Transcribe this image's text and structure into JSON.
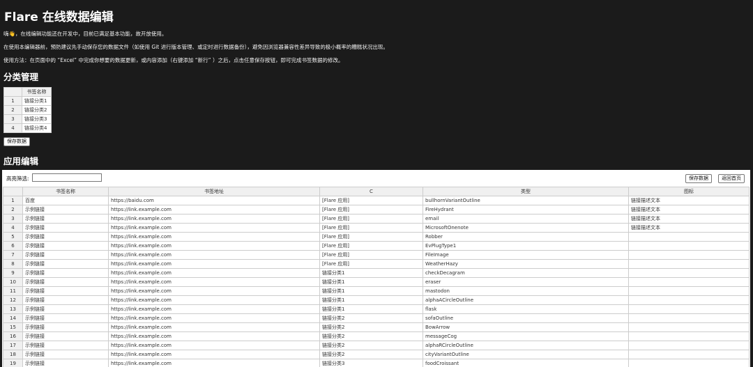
{
  "page": {
    "title": "Flare 在线数据编辑",
    "intro_1": "嗨👋，在线编辑功能还在开发中，目前已满足基本功能，故开放使用。",
    "intro_2": "在使用本编辑器前，预防建议先手动保存您的数据文件（如使用 Git 进行版本管理、或定时进行数据备份），避免因浏览器兼容性差异导致的极小概率的糟糕状况出现。",
    "intro_3": "使用方法：在页面中的 “Excel” 中完成你想要的数据更新，或内容添加（右键添加 “新行” ）之后，点击任意保存按钮，即可完成书签数据的修改。"
  },
  "category": {
    "heading": "分类管理",
    "column": "书签名称",
    "rows": [
      "链接分类1",
      "链接分类2",
      "链接分类3",
      "链接分类4"
    ],
    "save_label": "保存数据"
  },
  "apps": {
    "heading": "应用编辑",
    "filter_label": "高亮筛选:",
    "filter_value": "",
    "save_label": "保存数据",
    "home_label": "返回首页",
    "columns": [
      "书签名称",
      "书签地址",
      "C",
      "类型",
      "图标"
    ],
    "rows": [
      [
        "百度",
        "https://baidu.com",
        "[Flare 应用]",
        "bullhornVariantOutline",
        "链接描述文本"
      ],
      [
        "示例链接",
        "https://link.example.com",
        "[Flare 应用]",
        "FireHydrant",
        "链接描述文本"
      ],
      [
        "示例链接",
        "https://link.example.com",
        "[Flare 应用]",
        "email",
        "链接描述文本"
      ],
      [
        "示例链接",
        "https://link.example.com",
        "[Flare 应用]",
        "MicrosoftOnenote",
        "链接描述文本"
      ],
      [
        "示例链接",
        "https://link.example.com",
        "[Flare 应用]",
        "Robber",
        ""
      ],
      [
        "示例链接",
        "https://link.example.com",
        "[Flare 应用]",
        "EvPlugType1",
        ""
      ],
      [
        "示例链接",
        "https://link.example.com",
        "[Flare 应用]",
        "FileImage",
        ""
      ],
      [
        "示例链接",
        "https://link.example.com",
        "[Flare 应用]",
        "WeatherHazy",
        ""
      ],
      [
        "示例链接",
        "https://link.example.com",
        "链接分类1",
        "checkDecagram",
        ""
      ],
      [
        "示例链接",
        "https://link.example.com",
        "链接分类1",
        "eraser",
        ""
      ],
      [
        "示例链接",
        "https://link.example.com",
        "链接分类1",
        "mastodon",
        ""
      ],
      [
        "示例链接",
        "https://link.example.com",
        "链接分类1",
        "alphaACircleOutline",
        ""
      ],
      [
        "示例链接",
        "https://link.example.com",
        "链接分类1",
        "flask",
        ""
      ],
      [
        "示例链接",
        "https://link.example.com",
        "链接分类2",
        "sofaOutline",
        ""
      ],
      [
        "示例链接",
        "https://link.example.com",
        "链接分类2",
        "BowArrow",
        ""
      ],
      [
        "示例链接",
        "https://link.example.com",
        "链接分类2",
        "messageCog",
        ""
      ],
      [
        "示例链接",
        "https://link.example.com",
        "链接分类2",
        "alphaRCircleOutline",
        ""
      ],
      [
        "示例链接",
        "https://link.example.com",
        "链接分类2",
        "cityVariantOutline",
        ""
      ],
      [
        "示例链接",
        "https://link.example.com",
        "链接分类3",
        "foodCroissant",
        ""
      ]
    ]
  }
}
